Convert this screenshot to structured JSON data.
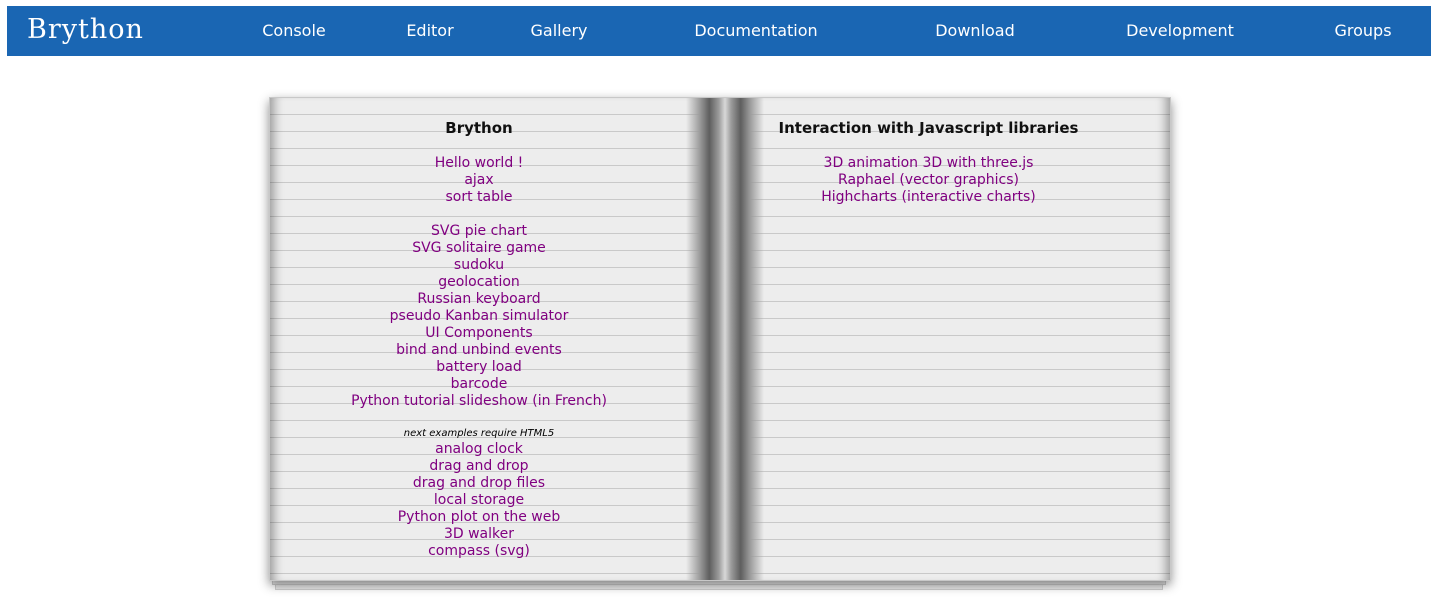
{
  "nav": {
    "logo": "Brython",
    "links": [
      "Console",
      "Editor",
      "Gallery",
      "Documentation",
      "Download",
      "Development",
      "Groups"
    ]
  },
  "left_column": {
    "title": "Brython",
    "group1": [
      "Hello world !",
      "ajax",
      "sort table"
    ],
    "group2": [
      "SVG pie chart",
      "SVG solitaire game",
      "sudoku",
      "geolocation",
      "Russian keyboard",
      "pseudo Kanban simulator",
      "UI Components",
      "bind and unbind events",
      "battery load",
      "barcode",
      "Python tutorial slideshow (in French)"
    ],
    "note": "next examples require HTML5",
    "group3": [
      "analog clock",
      "drag and drop",
      "drag and drop files",
      "local storage",
      "Python plot on the web",
      "3D walker",
      "compass (svg)"
    ]
  },
  "right_column": {
    "title": "Interaction with Javascript libraries",
    "links": [
      "3D animation 3D with three.js",
      "Raphael (vector graphics)",
      "Highcharts (interactive charts)"
    ]
  },
  "colors": {
    "navbar": "#1a66b3",
    "link": "#800080",
    "page": "#ededed"
  }
}
